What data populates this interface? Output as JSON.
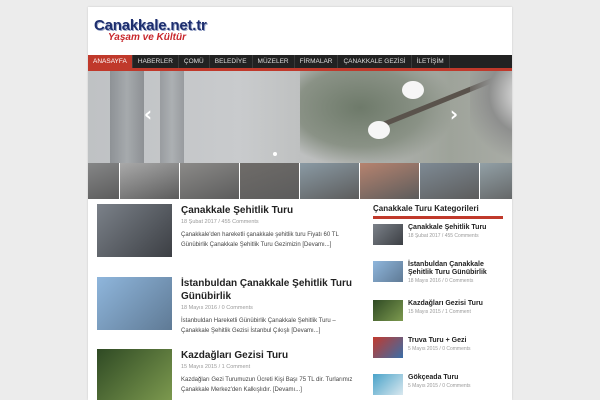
{
  "site": {
    "logo_line1": "Canakkale.net.tr",
    "logo_line2": "Yaşam ve Kültür"
  },
  "nav": {
    "items": [
      {
        "label": "ANASAYFA",
        "active": true
      },
      {
        "label": "HABERLER"
      },
      {
        "label": "ÇOMÜ"
      },
      {
        "label": "BELEDİYE"
      },
      {
        "label": "MÜZELER"
      },
      {
        "label": "FİRMALAR"
      },
      {
        "label": "ÇANAKKALE GEZİSİ"
      },
      {
        "label": "İLETİŞİM"
      }
    ]
  },
  "slider": {
    "prev_icon": "chevron-left-icon",
    "next_icon": "chevron-right-icon",
    "prev_glyph": "‹",
    "next_glyph": "›"
  },
  "thumbnails": [
    "#7f8c8a",
    "#8e8f90",
    "#a9a9a9",
    "#8b8a88",
    "#6f6c69",
    "#8a9aa4",
    "#b6836f",
    "#7e8a94",
    "#92a0a6",
    "#a8b0a8"
  ],
  "articles": [
    {
      "title": "Çanakkale Şehitlik Turu",
      "date": "18 Şubat 2017",
      "comments": "455 Comments",
      "excerpt": "Çanakkale'den hareketli çanakkale şehitlik turu  Fiyatı 60 TL Günübirlik Çanakkale Şehitlik Turu Gezimizin [Devamı...]",
      "image_colors": [
        "#7b8189",
        "#3c3f44"
      ]
    },
    {
      "title": "İstanbuldan Çanakkale Şehitlik Turu Günübirlik",
      "date": "18 Mayıs 2016",
      "comments": "0 Comments",
      "excerpt": "İstanbuldan Hareketli Günübirlik Çanakkale Şehitlik Turu – Çanakkale Şehitlik Gezisi İstanbul Çıkışlı [Devamı...]",
      "image_colors": [
        "#8fb6dc",
        "#5f7a95"
      ]
    },
    {
      "title": "Kazdağları Gezisi Turu",
      "date": "15 Mayıs 2015",
      "comments": "1 Comment",
      "excerpt": "Kazdağları Gezi Turumuzun Ücreti Kişi Başı 75 TL dir. Turlarımız Çanakkale Merkez'den Kalkışlıdır. [Devamı...]",
      "image_colors": [
        "#2f4a24",
        "#7d9a4f"
      ]
    }
  ],
  "sidebar": {
    "title": "Çanakkale Turu Kategorileri",
    "items": [
      {
        "name": "Çanakkale Şehitlik Turu",
        "date": "18 Şubat 2017",
        "comments": "455 Comments",
        "image_colors": [
          "#7b8189",
          "#3c3f44"
        ]
      },
      {
        "name": "İstanbuldan Çanakkale Şehitlik Turu Günübirlik",
        "date": "18 Mayıs 2016",
        "comments": "0 Comments",
        "image_colors": [
          "#8fb6dc",
          "#5f7a95"
        ]
      },
      {
        "name": "Kazdağları Gezisi Turu",
        "date": "15 Mayıs 2015",
        "comments": "1 Comment",
        "image_colors": [
          "#2f4a24",
          "#7d9a4f"
        ]
      },
      {
        "name": "Truva Turu + Gezi",
        "date": "5 Mayıs 2015",
        "comments": "0 Comments",
        "image_colors": [
          "#c23a2e",
          "#3a6ea8"
        ]
      },
      {
        "name": "Gökçeada Turu",
        "date": "5 Mayıs 2015",
        "comments": "0 Comments",
        "image_colors": [
          "#4aa3c9",
          "#d9e8ef"
        ]
      }
    ]
  }
}
